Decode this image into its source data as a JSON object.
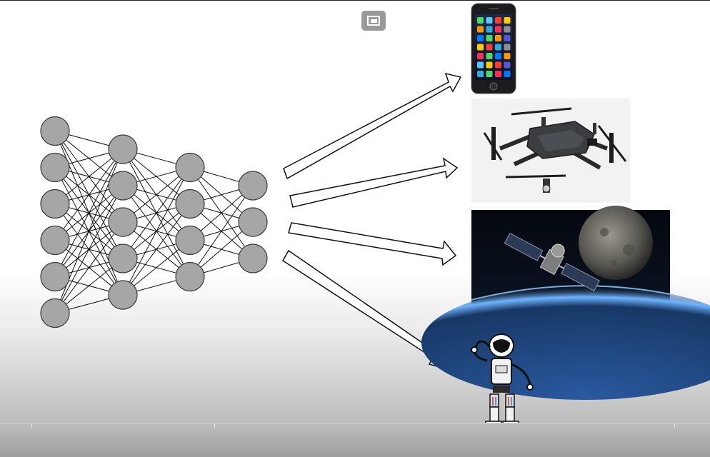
{
  "colors": {
    "neuron_fill": "#a6a6a6",
    "neuron_stroke": "#3a3a3a",
    "connection": "#111111",
    "arrow_fill": "#ffffff",
    "arrow_stroke": "#111111",
    "control_bg": "#9a9a9a"
  },
  "network": {
    "layers": [
      {
        "name": "input-layer",
        "nodes": 6
      },
      {
        "name": "hidden-layer-1",
        "nodes": 5
      },
      {
        "name": "hidden-layer-2",
        "nodes": 4
      },
      {
        "name": "output-layer",
        "nodes": 3
      }
    ]
  },
  "targets": [
    {
      "name": "smartphone",
      "icon": "smartphone-icon"
    },
    {
      "name": "drone",
      "icon": "drone-icon"
    },
    {
      "name": "satellite",
      "icon": "satellite-icon"
    },
    {
      "name": "robot",
      "icon": "robot-icon"
    }
  ],
  "controls": {
    "pip_icon": "picture-in-picture-icon"
  }
}
